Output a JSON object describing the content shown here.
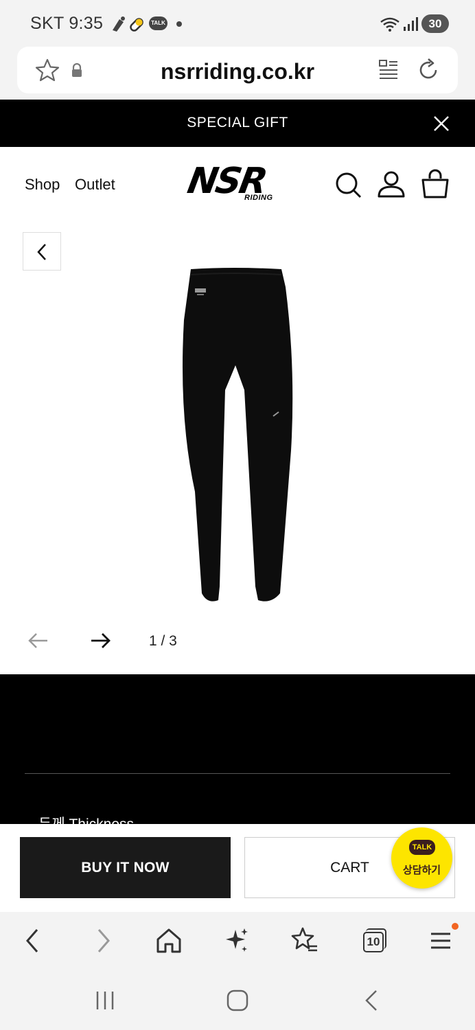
{
  "status_bar": {
    "carrier_time": "SKT 9:35",
    "battery": "30",
    "icons": [
      "bike-icon",
      "pill-icon",
      "talk-icon",
      "dot-icon",
      "wifi-icon",
      "signal-icon",
      "battery-icon"
    ],
    "talk_small": "TALK"
  },
  "browser": {
    "url": "nsrriding.co.kr"
  },
  "promo": {
    "text": "SPECIAL GIFT"
  },
  "header": {
    "nav": [
      "Shop",
      "Outlet"
    ],
    "logo_main": "NSR",
    "logo_sub": "RIDING"
  },
  "gallery": {
    "counter": "1 / 3",
    "current": 1,
    "total": 3
  },
  "detail": {
    "label": "두께 Thickness"
  },
  "actions": {
    "buy_label": "BUY IT NOW",
    "cart_label": "CART"
  },
  "kakao": {
    "badge": "TALK",
    "label": "상담하기"
  },
  "browser_toolbar": {
    "tabs_count": "10"
  },
  "colors": {
    "black": "#000000",
    "buy_button": "#1a1a1a",
    "kakao_yellow": "#fde500",
    "notification_dot": "#f26522",
    "chrome_bg": "#f3f3f3"
  }
}
